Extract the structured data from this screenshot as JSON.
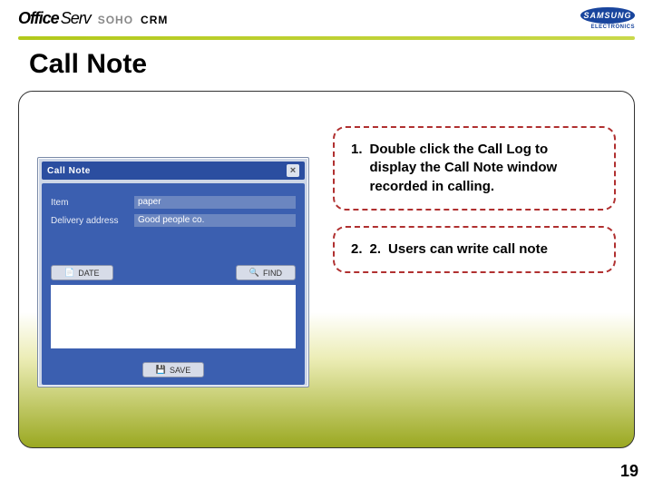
{
  "brand": {
    "office": "Office",
    "serv": "Serv",
    "soho": "SOHO",
    "crm": "CRM"
  },
  "vendor": {
    "name": "SAMSUNG",
    "sub": "ELECTRONICS"
  },
  "title": "Call Note",
  "callnote": {
    "window_title": "Call Note",
    "close_glyph": "×",
    "labels": {
      "item": "Item",
      "delivery": "Delivery address"
    },
    "values": {
      "item": "paper",
      "delivery": "Good people co."
    },
    "buttons": {
      "date": "DATE",
      "find": "FIND",
      "save": "SAVE"
    },
    "icons": {
      "date": "📄",
      "find": "🔍",
      "save": "💾"
    }
  },
  "callouts": {
    "c1": {
      "num": "1.",
      "text": "Double click the Call Log to display the Call Note window recorded in calling."
    },
    "c2": {
      "num": "2.",
      "num_inner": "2.",
      "text": "Users can write call note"
    }
  },
  "page_number": "19"
}
